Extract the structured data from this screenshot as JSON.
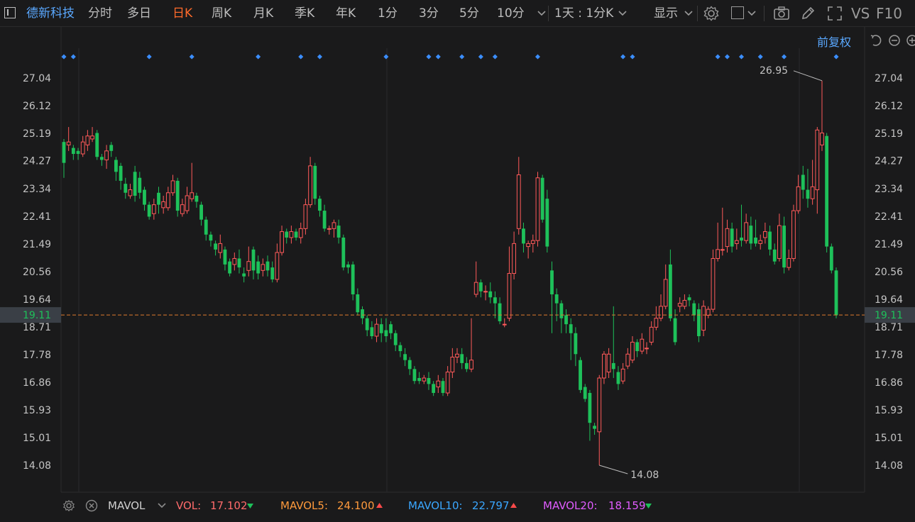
{
  "toolbar": {
    "stock_name": "德新科技",
    "periods": [
      "分时",
      "多日",
      "日K",
      "周K",
      "月K",
      "季K",
      "年K",
      "1分",
      "3分",
      "5分",
      "10分"
    ],
    "active_period": "日K",
    "multi_period": "1天 : 1分K",
    "display_label": "显示",
    "vs_label": "VS",
    "f10_label": "F10",
    "icons": [
      "sidebar-toggle-icon",
      "chevron-down-icon",
      "gear-icon",
      "box-select-icon",
      "camera-icon",
      "pencil-icon",
      "fullscreen-icon"
    ]
  },
  "chart_header": {
    "adjust_label": "前复权"
  },
  "indicator_bar": {
    "name": "MAVOL",
    "vol_label": "VOL:",
    "vol_value": "17.102",
    "mavol5_label": "MAVOL5:",
    "mavol5_value": "24.100",
    "mavol10_label": "MAVOL10:",
    "mavol10_value": "22.797",
    "mavol20_label": "MAVOL20:",
    "mavol20_value": "18.159",
    "colors": {
      "vol": "#ff6b6b",
      "mavol5": "#ff9a3c",
      "mavol10": "#3aa7ff",
      "mavol20": "#e05cff"
    }
  },
  "colors": {
    "up": "#ff5a5a",
    "down": "#1ec15a",
    "accent": "#ff6a2a",
    "marker": "#3b8eff",
    "price_line": "#e07a2e"
  },
  "chart_data": {
    "type": "candlestick",
    "y_ticks": [
      "27.04",
      "26.12",
      "25.19",
      "24.27",
      "23.34",
      "22.41",
      "21.49",
      "20.56",
      "19.64",
      "18.71",
      "17.78",
      "16.86",
      "15.93",
      "15.01",
      "14.08"
    ],
    "y_range": [
      14.08,
      27.04
    ],
    "current_price": "19.11",
    "max_label": "26.95",
    "min_label": "14.08",
    "candles": [
      [
        24.9,
        24.2,
        25.0,
        23.7
      ],
      [
        24.8,
        24.9,
        25.4,
        24.6
      ],
      [
        24.7,
        24.5,
        24.8,
        24.3
      ],
      [
        24.6,
        24.5,
        24.7,
        24.3
      ],
      [
        24.5,
        24.9,
        25.1,
        24.4
      ],
      [
        24.8,
        25.1,
        25.3,
        24.6
      ],
      [
        25.0,
        25.1,
        25.4,
        24.9
      ],
      [
        25.2,
        24.4,
        25.3,
        24.3
      ],
      [
        24.4,
        24.3,
        24.5,
        24.1
      ],
      [
        24.3,
        24.6,
        24.8,
        24.0
      ],
      [
        24.8,
        24.6,
        24.9,
        24.4
      ],
      [
        24.3,
        23.9,
        24.4,
        23.6
      ],
      [
        24.1,
        23.6,
        24.2,
        23.3
      ],
      [
        23.5,
        23.2,
        23.7,
        23.0
      ],
      [
        23.1,
        23.3,
        23.5,
        23.0
      ],
      [
        23.9,
        23.1,
        24.1,
        22.9
      ],
      [
        23.7,
        23.2,
        23.9,
        23.0
      ],
      [
        23.3,
        22.8,
        23.4,
        22.6
      ],
      [
        22.8,
        22.4,
        22.9,
        22.3
      ],
      [
        22.5,
        22.8,
        23.0,
        22.3
      ],
      [
        23.2,
        22.8,
        23.4,
        22.5
      ],
      [
        22.7,
        22.9,
        23.1,
        22.5
      ],
      [
        22.7,
        23.2,
        23.4,
        22.6
      ],
      [
        23.2,
        23.6,
        23.8,
        23.1
      ],
      [
        23.6,
        22.6,
        23.7,
        22.4
      ],
      [
        22.5,
        22.8,
        23.0,
        22.4
      ],
      [
        22.6,
        23.1,
        23.4,
        22.5
      ],
      [
        23.0,
        23.2,
        24.2,
        22.9
      ],
      [
        23.1,
        22.9,
        23.2,
        22.7
      ],
      [
        22.8,
        22.3,
        22.9,
        22.1
      ],
      [
        22.3,
        21.8,
        22.4,
        21.6
      ],
      [
        21.8,
        21.6,
        21.9,
        21.4
      ],
      [
        21.5,
        21.3,
        21.6,
        21.1
      ],
      [
        21.2,
        21.5,
        21.8,
        21.0
      ],
      [
        21.3,
        20.8,
        21.4,
        20.6
      ],
      [
        20.9,
        20.5,
        21.0,
        20.4
      ],
      [
        20.8,
        21.0,
        21.2,
        20.6
      ],
      [
        21.0,
        20.7,
        21.3,
        20.5
      ],
      [
        20.5,
        20.4,
        20.7,
        20.2
      ],
      [
        20.6,
        20.9,
        21.4,
        20.4
      ],
      [
        21.3,
        20.6,
        21.4,
        20.3
      ],
      [
        20.9,
        20.5,
        21.1,
        20.3
      ],
      [
        20.6,
        20.8,
        21.0,
        20.4
      ],
      [
        20.9,
        20.6,
        21.1,
        20.4
      ],
      [
        20.7,
        20.3,
        20.9,
        20.2
      ],
      [
        20.3,
        21.2,
        21.5,
        20.2
      ],
      [
        21.2,
        21.9,
        22.1,
        21.1
      ],
      [
        21.9,
        21.7,
        22.0,
        21.5
      ],
      [
        21.7,
        21.9,
        22.1,
        21.5
      ],
      [
        21.9,
        21.7,
        22.0,
        21.6
      ],
      [
        21.7,
        22.0,
        22.2,
        21.5
      ],
      [
        22.0,
        22.8,
        23.0,
        21.8
      ],
      [
        22.8,
        24.1,
        24.4,
        22.7
      ],
      [
        24.1,
        23.0,
        24.2,
        22.8
      ],
      [
        23.0,
        22.6,
        23.1,
        22.4
      ],
      [
        22.6,
        22.0,
        22.8,
        21.9
      ],
      [
        22.0,
        22.0,
        22.1,
        21.8
      ],
      [
        22.0,
        22.2,
        22.3,
        21.7
      ],
      [
        22.1,
        21.7,
        22.3,
        21.5
      ],
      [
        21.7,
        20.7,
        21.8,
        20.6
      ],
      [
        20.8,
        20.7,
        20.9,
        20.5
      ],
      [
        20.8,
        19.8,
        20.9,
        19.6
      ],
      [
        19.8,
        19.2,
        20.0,
        19.1
      ],
      [
        19.3,
        19.0,
        19.4,
        18.8
      ],
      [
        19.0,
        18.6,
        19.1,
        18.4
      ],
      [
        18.7,
        18.4,
        18.9,
        18.3
      ],
      [
        18.4,
        18.8,
        19.0,
        18.2
      ],
      [
        18.8,
        18.5,
        19.0,
        18.2
      ],
      [
        18.6,
        18.4,
        19.0,
        18.2
      ],
      [
        18.8,
        18.5,
        18.9,
        18.3
      ],
      [
        18.5,
        18.1,
        18.6,
        17.9
      ],
      [
        18.1,
        17.9,
        18.2,
        17.7
      ],
      [
        17.8,
        17.6,
        18.0,
        17.4
      ],
      [
        17.6,
        17.3,
        17.7,
        17.1
      ],
      [
        17.3,
        16.9,
        17.4,
        16.8
      ],
      [
        17.0,
        16.9,
        17.2,
        16.8
      ],
      [
        16.9,
        17.0,
        17.1,
        16.8
      ],
      [
        17.0,
        16.8,
        17.2,
        16.6
      ],
      [
        16.8,
        16.5,
        16.9,
        16.4
      ],
      [
        16.7,
        16.9,
        17.1,
        16.5
      ],
      [
        16.9,
        16.5,
        17.0,
        16.4
      ],
      [
        16.5,
        17.2,
        17.4,
        16.4
      ],
      [
        17.2,
        17.7,
        18.0,
        17.0
      ],
      [
        17.7,
        17.8,
        18.0,
        17.5
      ],
      [
        17.8,
        17.5,
        18.0,
        17.3
      ],
      [
        17.5,
        17.3,
        17.7,
        17.2
      ],
      [
        17.3,
        17.6,
        19.0,
        17.2
      ],
      [
        19.8,
        20.2,
        20.9,
        19.7
      ],
      [
        20.2,
        19.9,
        20.3,
        19.7
      ],
      [
        19.9,
        19.9,
        20.1,
        19.6
      ],
      [
        19.9,
        19.7,
        20.2,
        19.5
      ],
      [
        19.7,
        19.5,
        19.9,
        19.0
      ],
      [
        19.5,
        18.9,
        19.7,
        18.8
      ],
      [
        18.8,
        18.8,
        19.0,
        18.7
      ],
      [
        19.0,
        20.5,
        21.4,
        18.9
      ],
      [
        20.5,
        21.5,
        21.9,
        20.3
      ],
      [
        22.0,
        23.8,
        24.4,
        21.8
      ],
      [
        22.0,
        21.5,
        22.2,
        21.2
      ],
      [
        21.4,
        21.5,
        21.6,
        21.0
      ],
      [
        21.5,
        21.6,
        21.8,
        21.2
      ],
      [
        21.6,
        23.7,
        23.9,
        21.4
      ],
      [
        23.7,
        22.3,
        23.8,
        22.2
      ],
      [
        23.0,
        21.4,
        23.3,
        21.2
      ],
      [
        20.6,
        19.8,
        20.9,
        18.5
      ],
      [
        19.8,
        19.5,
        20.0,
        18.9
      ],
      [
        19.5,
        19.0,
        19.6,
        18.5
      ],
      [
        19.1,
        18.8,
        19.3,
        18.5
      ],
      [
        18.8,
        18.5,
        19.0,
        17.6
      ],
      [
        18.5,
        17.8,
        18.7,
        17.4
      ],
      [
        17.6,
        16.6,
        17.7,
        16.5
      ],
      [
        16.7,
        16.3,
        16.8,
        16.2
      ],
      [
        16.5,
        15.5,
        16.6,
        14.9
      ],
      [
        15.4,
        15.3,
        15.5,
        15.1
      ],
      [
        15.2,
        17.0,
        17.1,
        14.08
      ],
      [
        17.0,
        17.8,
        17.9,
        16.8
      ],
      [
        17.2,
        17.8,
        18.0,
        17.0
      ],
      [
        17.5,
        17.3,
        19.4,
        17.0
      ],
      [
        17.2,
        16.8,
        17.4,
        16.6
      ],
      [
        16.9,
        17.3,
        17.5,
        16.8
      ],
      [
        17.4,
        17.8,
        18.0,
        17.3
      ],
      [
        17.6,
        18.2,
        18.4,
        17.5
      ],
      [
        18.2,
        17.9,
        18.3,
        17.7
      ],
      [
        17.9,
        18.3,
        18.5,
        17.8
      ],
      [
        18.0,
        18.0,
        18.2,
        17.8
      ],
      [
        18.2,
        18.7,
        18.9,
        18.1
      ],
      [
        18.7,
        19.0,
        19.4,
        18.6
      ],
      [
        19.0,
        19.4,
        19.8,
        18.9
      ],
      [
        19.4,
        20.3,
        20.8,
        19.3
      ],
      [
        20.8,
        19.0,
        21.3,
        18.9
      ],
      [
        19.0,
        18.2,
        19.3,
        18.1
      ],
      [
        19.4,
        19.5,
        19.7,
        19.2
      ],
      [
        19.4,
        19.6,
        19.8,
        19.3
      ],
      [
        19.7,
        19.6,
        19.8,
        19.4
      ],
      [
        19.5,
        19.1,
        19.6,
        18.9
      ],
      [
        19.3,
        18.4,
        19.5,
        18.2
      ],
      [
        18.6,
        19.4,
        19.6,
        18.4
      ],
      [
        19.1,
        19.3,
        19.4,
        19.0
      ],
      [
        19.3,
        21.0,
        21.3,
        19.2
      ],
      [
        21.0,
        21.3,
        22.2,
        20.9
      ],
      [
        21.3,
        21.3,
        22.7,
        21.1
      ],
      [
        21.4,
        22.0,
        22.3,
        21.2
      ],
      [
        22.0,
        21.4,
        22.2,
        21.2
      ],
      [
        21.5,
        21.6,
        22.0,
        21.3
      ],
      [
        21.7,
        21.6,
        22.8,
        21.4
      ],
      [
        21.6,
        22.2,
        22.5,
        21.5
      ],
      [
        22.1,
        21.5,
        22.4,
        21.3
      ],
      [
        21.7,
        21.5,
        22.3,
        21.4
      ],
      [
        21.5,
        21.6,
        21.8,
        21.3
      ],
      [
        21.7,
        21.9,
        22.2,
        21.5
      ],
      [
        21.9,
        21.3,
        22.1,
        21.1
      ],
      [
        21.3,
        20.9,
        21.5,
        20.8
      ],
      [
        21.0,
        22.1,
        22.5,
        20.9
      ],
      [
        22.1,
        20.7,
        22.4,
        20.5
      ],
      [
        20.7,
        21.0,
        21.3,
        20.6
      ],
      [
        21.0,
        22.6,
        22.8,
        20.9
      ],
      [
        22.6,
        23.4,
        23.8,
        22.5
      ],
      [
        23.8,
        23.3,
        24.1,
        23.0
      ],
      [
        23.3,
        23.0,
        24.0,
        22.7
      ],
      [
        23.0,
        23.4,
        24.3,
        22.8
      ],
      [
        23.3,
        25.3,
        25.4,
        22.5
      ],
      [
        24.8,
        25.2,
        26.95,
        24.6
      ],
      [
        25.1,
        21.4,
        25.2,
        21.2
      ],
      [
        21.4,
        20.6,
        21.5,
        20.5
      ],
      [
        20.6,
        19.1,
        20.7,
        19.0
      ]
    ],
    "markers_x": [
      0,
      1,
      8,
      12,
      18,
      22,
      24,
      30,
      34,
      35,
      37,
      39,
      40,
      44,
      52,
      53,
      61,
      62,
      63,
      65,
      67,
      72
    ]
  }
}
